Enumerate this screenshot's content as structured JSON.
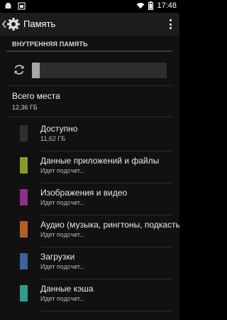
{
  "status_bar": {
    "time": "17:48",
    "icons": [
      "android-debug-icon",
      "screenshot-icon",
      "wifi-icon",
      "battery-icon"
    ]
  },
  "action_bar": {
    "title": "Память",
    "icons": [
      "back-arrow-icon",
      "gear-icon",
      "overflow-menu-icon"
    ]
  },
  "section": {
    "header": "ВНУТРЕННЯЯ ПАМЯТЬ",
    "usage_fraction": 0.06
  },
  "total": {
    "label": "Всего места",
    "value": "12,36 ГБ"
  },
  "categories": [
    {
      "label": "Доступно",
      "sub": "11,62 ГБ",
      "color": "#2f2f2f"
    },
    {
      "label": "Данные приложений и файлы",
      "sub": "Идет подсчет...",
      "color": "#8a9a2a"
    },
    {
      "label": "Изображения и видео",
      "sub": "Идет подсчет...",
      "color": "#8e2f8e"
    },
    {
      "label": "Аудио (музыка, рингтоны, подкасты)",
      "sub": "Идет подсчет...",
      "color": "#b25f22"
    },
    {
      "label": "Загрузки",
      "sub": "Идет подсчет...",
      "color": "#3f5f9e"
    },
    {
      "label": "Данные кэша",
      "sub": "Идет подсчет...",
      "color": "#2f9c8c"
    }
  ]
}
